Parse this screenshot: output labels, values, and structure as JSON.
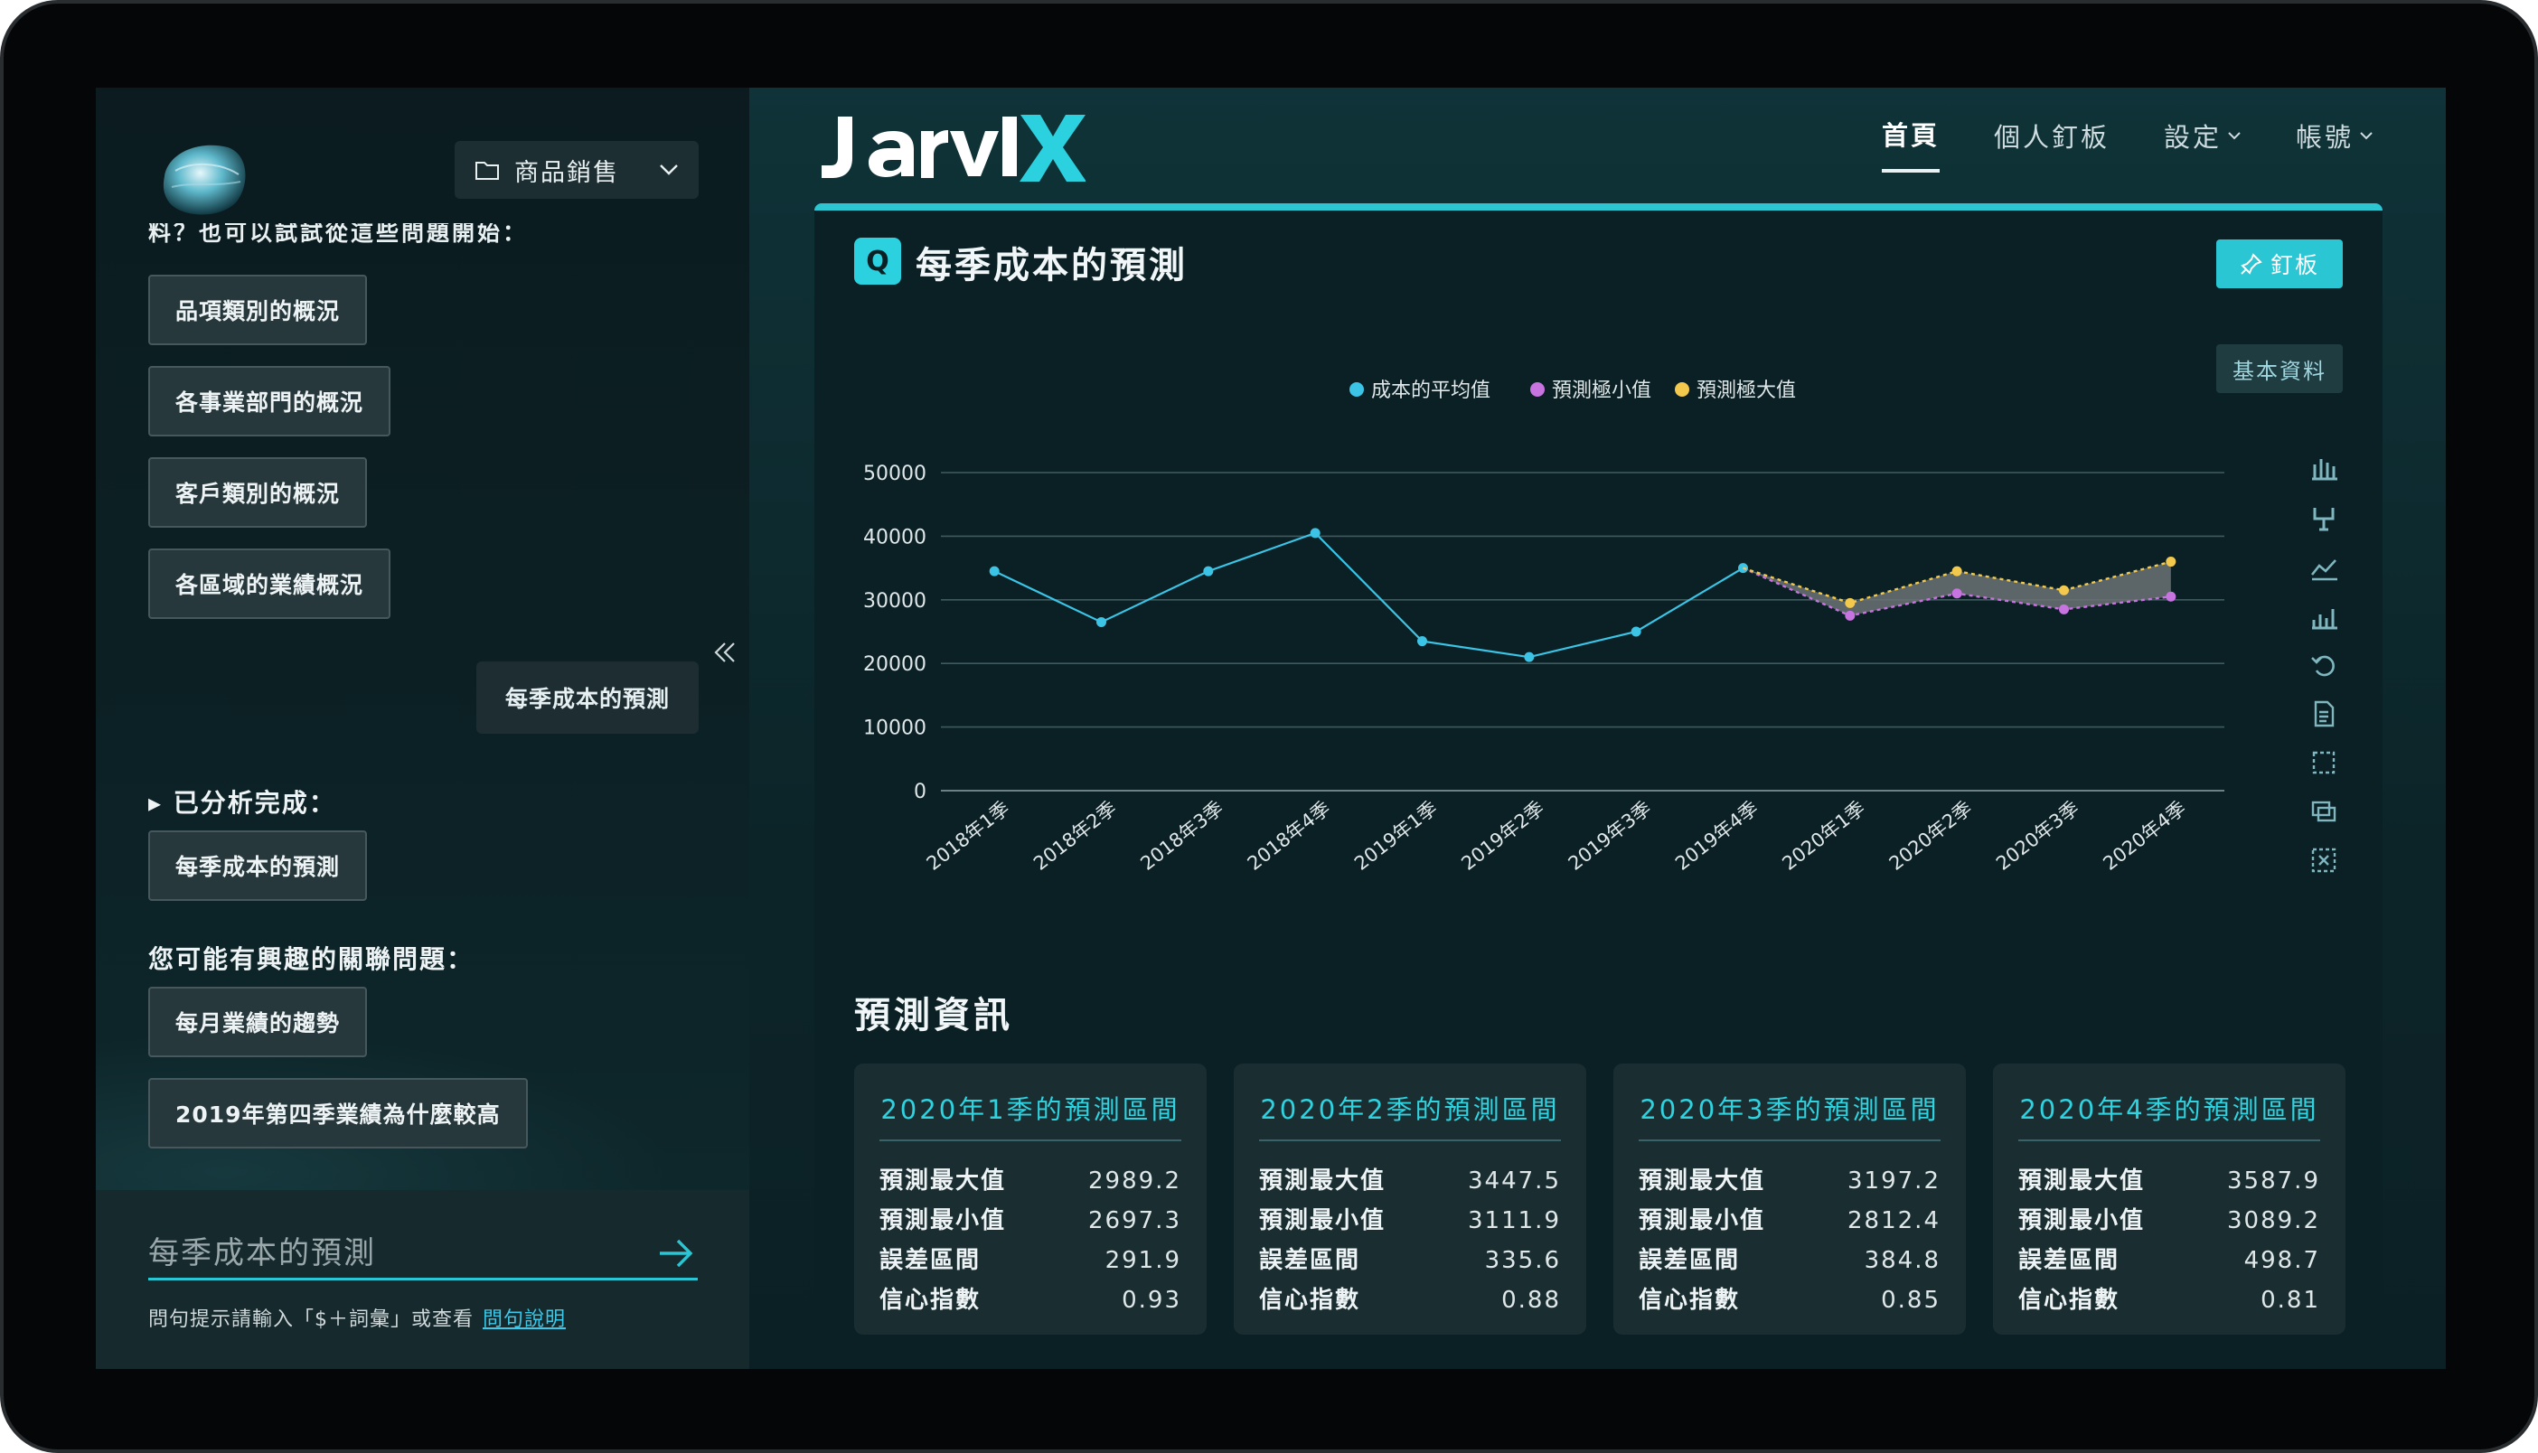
{
  "project": {
    "label": "商品銷售"
  },
  "sidebar": {
    "hint": "料？也可以試試從這些問題開始：",
    "suggestions": [
      "品項類別的概況",
      "各事業部門的概況",
      "客戶類別的概況",
      "各區域的業績概況"
    ],
    "user_query": "每季成本的預測",
    "done_label": "▸ 已分析完成：",
    "done_items": [
      "每季成本的預測"
    ],
    "related_label": "您可能有興趣的關聯問題：",
    "related_items": [
      "每月業績的趨勢",
      "2019年第四季業績為什麼較高"
    ],
    "input_placeholder": "每季成本的預測",
    "help_text": "問句提示請輸入「$＋詞彙」或查看",
    "help_link": "問句說明"
  },
  "nav": {
    "home": "首頁",
    "pins": "個人釘板",
    "settings": "設定",
    "account": "帳號"
  },
  "card": {
    "q_badge": "Q",
    "title": "每季成本的預測",
    "pin_label": "釘板",
    "basic_label": "基本資料"
  },
  "chart_data": {
    "type": "line",
    "categories": [
      "2018年1季",
      "2018年2季",
      "2018年3季",
      "2018年4季",
      "2019年1季",
      "2019年2季",
      "2019年3季",
      "2019年4季",
      "2020年1季",
      "2020年2季",
      "2020年3季",
      "2020年4季"
    ],
    "series": [
      {
        "name": "成本的平均值",
        "color": "#3bc4e6",
        "values": [
          34500,
          26500,
          34500,
          40500,
          23500,
          21000,
          25000,
          35000,
          null,
          null,
          null,
          null
        ]
      },
      {
        "name": "預測極小值",
        "color": "#c774e0",
        "values": [
          null,
          null,
          null,
          null,
          null,
          null,
          null,
          35000,
          27500,
          31000,
          28500,
          30500
        ]
      },
      {
        "name": "預測極大值",
        "color": "#f2c94c",
        "values": [
          null,
          null,
          null,
          null,
          null,
          null,
          null,
          35000,
          29500,
          34500,
          31500,
          36000
        ]
      }
    ],
    "ylim": [
      0,
      50000
    ],
    "yticks": [
      0,
      10000,
      20000,
      30000,
      40000,
      50000
    ],
    "grid": true,
    "legend_position": "top-center",
    "band_color": "#6b7274"
  },
  "forecast": {
    "title": "預測資訊",
    "labels": {
      "max": "預測最大值",
      "min": "預測最小值",
      "err": "誤差區間",
      "conf": "信心指數"
    },
    "cards": [
      {
        "title": "2020年1季的預測區間",
        "max": "2989.2",
        "min": "2697.3",
        "err": "291.9",
        "conf": "0.93"
      },
      {
        "title": "2020年2季的預測區間",
        "max": "3447.5",
        "min": "3111.9",
        "err": "335.6",
        "conf": "0.88"
      },
      {
        "title": "2020年3季的預測區間",
        "max": "3197.2",
        "min": "2812.4",
        "err": "384.8",
        "conf": "0.85"
      },
      {
        "title": "2020年4季的預測區間",
        "max": "3587.9",
        "min": "3089.2",
        "err": "498.7",
        "conf": "0.81"
      }
    ]
  },
  "colors": {
    "accent": "#2bc6d4",
    "background": "#0b2024"
  }
}
